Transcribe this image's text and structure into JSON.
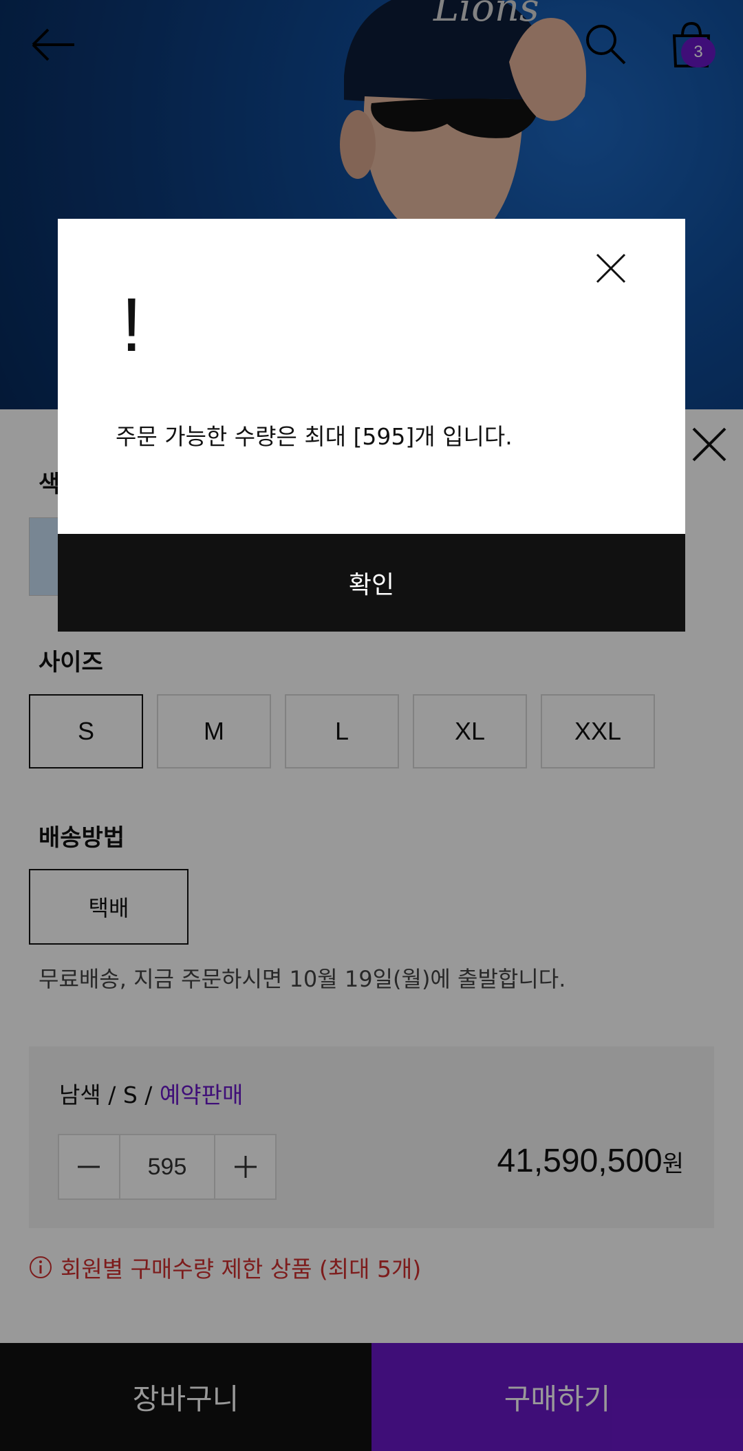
{
  "header": {
    "cart_count": "3",
    "hero_cap_text": "Lions"
  },
  "sections": {
    "color_title": "색상",
    "size_title": "사이즈",
    "shipping_title": "배송방법"
  },
  "sizes": [
    "S",
    "M",
    "L",
    "XL",
    "XXL"
  ],
  "selected_size": "S",
  "shipping": {
    "method": "택배",
    "note": "무료배송, 지금 주문하시면 10월 19일(월)에 출발합니다."
  },
  "option": {
    "name_prefix": "남색 / S / ",
    "name_tag": "예약판매",
    "quantity": "595",
    "price": "41,590,500",
    "currency": "원"
  },
  "limit_note": "회원별 구매수량 제한 상품 (최대 5개)",
  "bottom": {
    "cart_label": "장바구니",
    "buy_label": "구매하기"
  },
  "dialog": {
    "mark": "!",
    "message": "주문 가능한 수량은 최대 [595]개 입니다.",
    "confirm_label": "확인"
  },
  "colors": {
    "accent": "#6a18c9",
    "warning": "#d03030",
    "hero_bg": "#0f4c99"
  }
}
